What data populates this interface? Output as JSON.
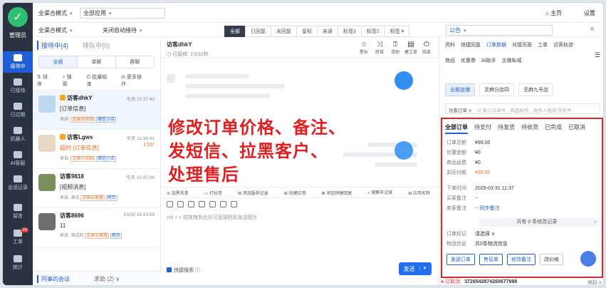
{
  "rail": {
    "role": "管理员",
    "items": [
      {
        "label": "接待中",
        "active": true
      },
      {
        "label": "已接待"
      },
      {
        "label": "已过期"
      },
      {
        "label": "机器人"
      },
      {
        "label": "AI客服"
      },
      {
        "label": "会话记录"
      },
      {
        "label": "留言"
      },
      {
        "label": "工单",
        "badge": "26"
      },
      {
        "label": "统计"
      }
    ]
  },
  "topbar": {
    "mode": "全渠合模式",
    "app": "全部应用",
    "mode2": "全渠合模式",
    "auto": "关闭自动接待",
    "tabs": [
      "全部",
      "已回复",
      "未回复",
      "星标",
      "未读",
      "标签3",
      "标签2",
      "标签 ▾"
    ],
    "home": "主页",
    "settings": "设置",
    "notice": "公告"
  },
  "list": {
    "tab_active": "接待中(4)",
    "tab_queue": "排队中(0)",
    "seg": [
      "全部",
      "单聊",
      "群聊"
    ],
    "tools": [
      "排序",
      "搜索",
      "批量结束",
      "更多操作"
    ],
    "convs": [
      {
        "name": "访客dhkY",
        "time": "今天 11:37:43",
        "msg": "[订单信息]",
        "src": "来自:",
        "b": "芝麻分店四",
        "c": "微信小店"
      },
      {
        "name": "访客Lgws",
        "time": "今天 11:36:41",
        "red": "1'55\"",
        "msg": "超时 [订单信息]",
        "src": "来自:",
        "b": "芝麻分店四",
        "c": "微信小店"
      },
      {
        "name": "访客9818",
        "time": "今天 10:47:04",
        "msg": "[视频消息]",
        "src": "来自: 测试",
        "b": "芝麻云客服",
        "c": "网页"
      },
      {
        "name": "访客8696",
        "time": "03/28 18:13:09",
        "msg": "11",
        "src": "来自: 测试的",
        "b": "芝麻云客服",
        "c": "网页"
      }
    ],
    "foot_a": "同事的会话",
    "foot_b": "求助 (2)"
  },
  "chat": {
    "name": "访客dhkY",
    "sub": "已接待: 1分31秒",
    "acts": [
      "星标",
      "转接",
      "求助",
      "建工单",
      "结束"
    ],
    "overlay": [
      "修改订单价格、备注、",
      "发短信、拉黑客户、",
      "处理售后"
    ],
    "tools": [
      "加黑名单",
      "打标签",
      "添加服务记录",
      "创建应用",
      "添加快捷回复",
      "搜聊天记录",
      "应用名称"
    ],
    "placeholder": "ctrl + v 或拖拽到此处可直接粘贴发送图片",
    "fast": "快捷搜索",
    "send": "发送"
  },
  "right": {
    "tabs1": [
      "资料",
      "快捷回复",
      "订单数据",
      "对接页面",
      "工单",
      "访客轨迹",
      "商品",
      "优惠券",
      "AI助手",
      "企微私域"
    ],
    "tabs1_on": "订单数据",
    "shops": [
      "全部店铺",
      "芝麻分店四",
      "芝麻九号店"
    ],
    "search_label": "访客订单 ∨",
    "search_ph": "Q 输入订单号、商品标号、收件人姓名/手机号",
    "order_tabs": [
      "全部订单",
      "待支付",
      "待发货",
      "待收货",
      "已完成",
      "已取消"
    ],
    "rows": [
      {
        "k": "订单总额",
        "v": "¥99.00"
      },
      {
        "k": "优惠金额",
        "v": "¥0"
      },
      {
        "k": "商品运费",
        "v": "¥0"
      },
      {
        "k": "实际付款",
        "v": "¥99.00",
        "amt": true
      },
      {
        "k": "下单时间",
        "v": "2025-03-31 11:37"
      },
      {
        "k": "买家备注",
        "v": "--"
      },
      {
        "k": "卖家备注",
        "v": "-- 同步备注",
        "lnk": true
      }
    ],
    "sync": "共有 0 条修改记录",
    "mark_k": "订单标记",
    "mark_v": "请选择 ∨",
    "logi_k": "物流信息",
    "logi_v": "共0条物流信息",
    "buttons": [
      "发送订单",
      "售后单",
      "修改备注",
      "改价格"
    ],
    "foot_status": "已取消",
    "foot_id": "3726542874260677888",
    "foot_more": "收起 ∧"
  }
}
